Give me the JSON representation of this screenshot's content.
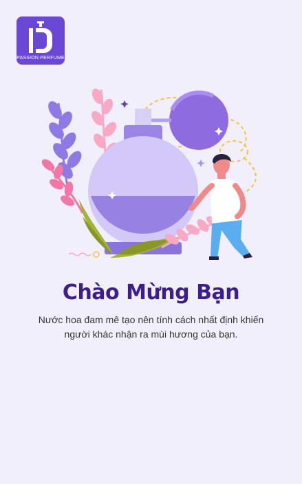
{
  "brand": {
    "name": "PASSION PERFUME",
    "color": "#6a47d4"
  },
  "welcome": {
    "title": "Chào Mừng Bạn",
    "description": "Nước hoa đam mê tạo nên tính cách nhất định khiến người khác nhận ra mùi hương của bạn."
  },
  "colors": {
    "background": "#f1effb",
    "title": "#3d1f8c",
    "text": "#333333"
  },
  "illustration": {
    "icon": "perfume-bottle-with-man-illustration"
  }
}
